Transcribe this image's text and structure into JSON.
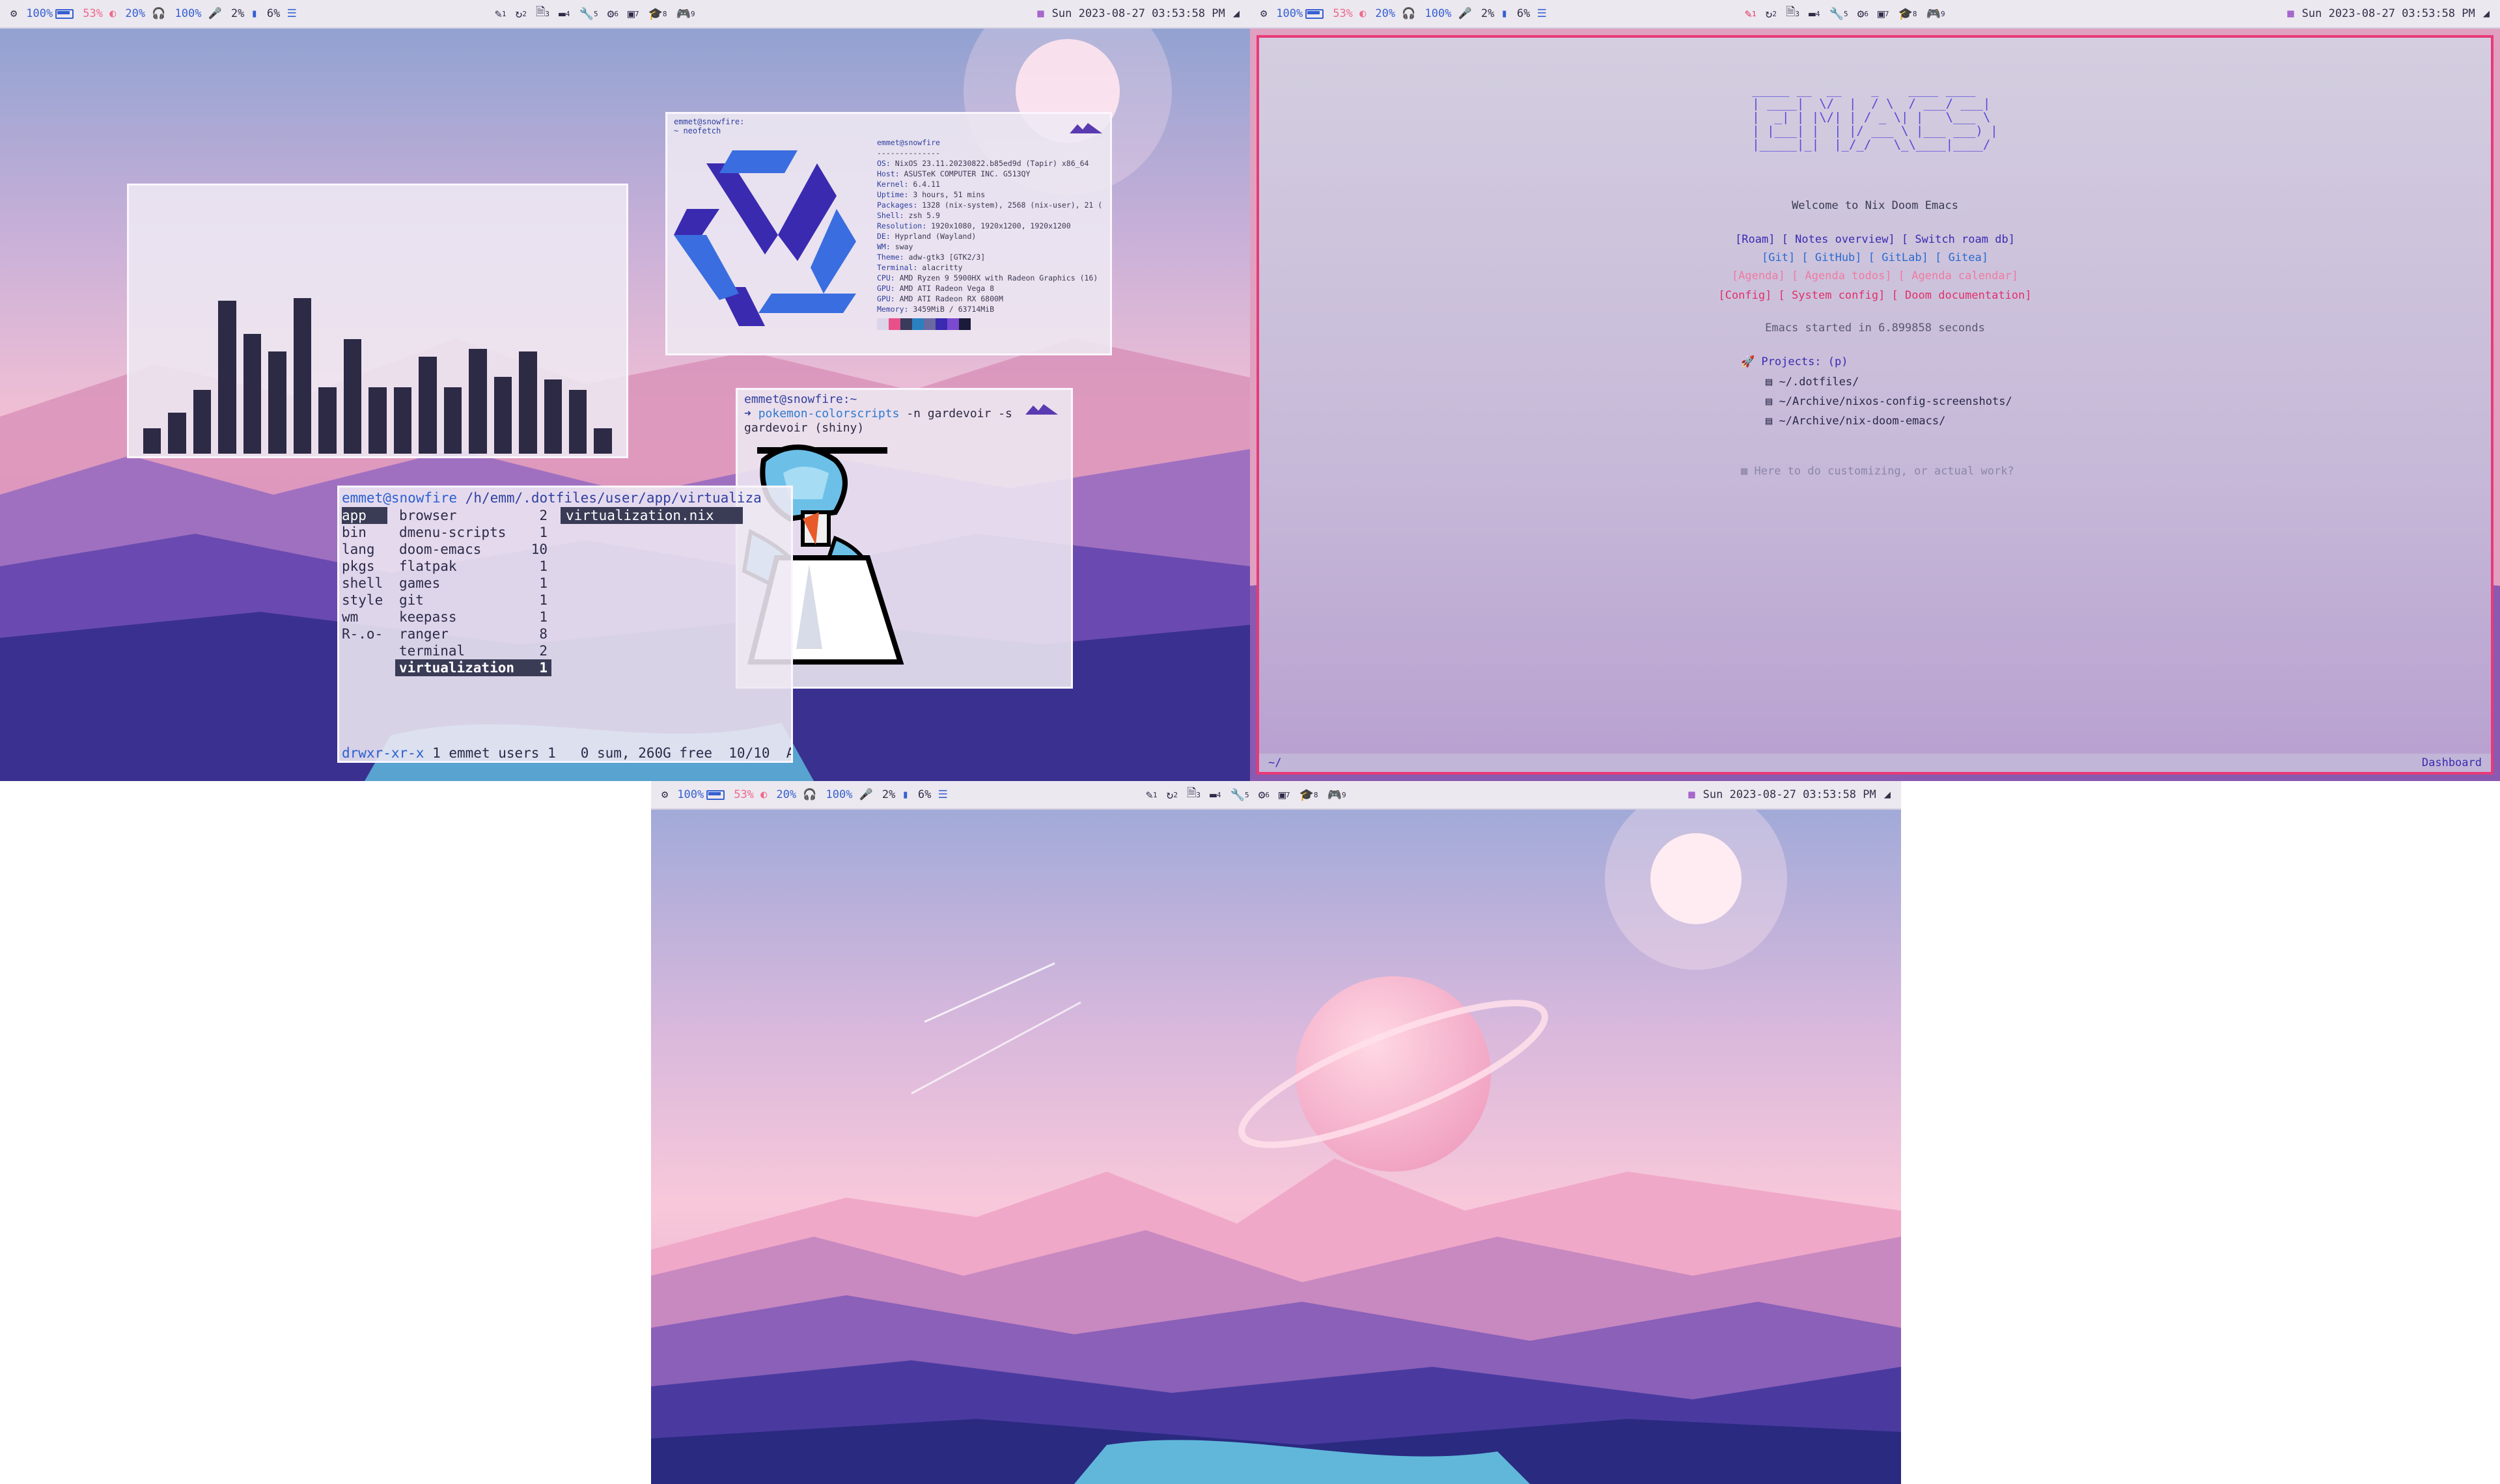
{
  "statusbar": {
    "cpu_icon": "gear-icon",
    "battery": "100%",
    "brightness": "53%",
    "volume": "20%",
    "mic": "100%",
    "ram": "2%",
    "disk": "6%",
    "workspaces": [
      {
        "icon": "pen-icon",
        "num": "1"
      },
      {
        "icon": "refresh-icon",
        "num": "2"
      },
      {
        "icon": "file-icon",
        "num": "3"
      },
      {
        "icon": "folder-icon",
        "num": "4"
      },
      {
        "icon": "wrench-icon",
        "num": "5"
      },
      {
        "icon": "gear-icon",
        "num": "6"
      },
      {
        "icon": "vm-icon",
        "num": "7"
      },
      {
        "icon": "graduation-icon",
        "num": "8"
      },
      {
        "icon": "gamepad-icon",
        "num": "9"
      }
    ],
    "datetime": "Sun 2023-08-27 03:53:58 PM",
    "colors": {
      "accent": "#3560d0",
      "warn": "#ee6a8a"
    }
  },
  "neofetch": {
    "prompt": "emmet@snowfire:",
    "command": "~ neofetch",
    "userhost": "emmet@snowfire",
    "separator": "--------------",
    "rows": [
      {
        "k": "OS:",
        "v": "NixOS 23.11.20230822.b85ed9d (Tapir) x86_64"
      },
      {
        "k": "Host:",
        "v": "ASUSTeK COMPUTER INC. G513QY"
      },
      {
        "k": "Kernel:",
        "v": "6.4.11"
      },
      {
        "k": "Uptime:",
        "v": "3 hours, 51 mins"
      },
      {
        "k": "Packages:",
        "v": "1328 (nix-system), 2568 (nix-user), 21 ("
      },
      {
        "k": "Shell:",
        "v": "zsh 5.9"
      },
      {
        "k": "Resolution:",
        "v": "1920x1080, 1920x1200, 1920x1200"
      },
      {
        "k": "DE:",
        "v": "Hyprland (Wayland)"
      },
      {
        "k": "WM:",
        "v": "sway"
      },
      {
        "k": "Theme:",
        "v": "adw-gtk3 [GTK2/3]"
      },
      {
        "k": "Terminal:",
        "v": "alacritty"
      },
      {
        "k": "CPU:",
        "v": "AMD Ryzen 9 5900HX with Radeon Graphics (16)"
      },
      {
        "k": "GPU:",
        "v": "AMD ATI Radeon Vega 8"
      },
      {
        "k": "GPU:",
        "v": "AMD ATI Radeon RX 6800M"
      },
      {
        "k": "Memory:",
        "v": "3459MiB / 63714MiB"
      }
    ]
  },
  "pokemon": {
    "prompt": "emmet@snowfire:~",
    "command": "pokemon-colorscripts",
    "args": "-n gardevoir -s",
    "output": "gardevoir (shiny)"
  },
  "ranger": {
    "header_user": "emmet@snowfire",
    "header_path": "/h/emm/.dotfiles/user/app/virtualiza",
    "col1": [
      "app",
      "bin",
      "lang",
      "pkgs",
      "shell",
      "style",
      "wm",
      "R-.o-"
    ],
    "col2": [
      {
        "name": "browser",
        "count": "2"
      },
      {
        "name": "dmenu-scripts",
        "count": "1"
      },
      {
        "name": "doom-emacs",
        "count": "10"
      },
      {
        "name": "flatpak",
        "count": "1"
      },
      {
        "name": "games",
        "count": "1"
      },
      {
        "name": "git",
        "count": "1"
      },
      {
        "name": "keepass",
        "count": "1"
      },
      {
        "name": "ranger",
        "count": "8"
      },
      {
        "name": "terminal",
        "count": "2"
      },
      {
        "name": "virtualization",
        "count": "1"
      }
    ],
    "col3": [
      "virtualization.nix"
    ],
    "footer_perm": "drwxr-xr-x",
    "footer_info": "1 emmet users 1",
    "footer_free": "0 sum, 260G free",
    "footer_pos": "10/10",
    "footer_all": "All"
  },
  "visualizer": {
    "values": [
      0.1,
      0.16,
      0.25,
      0.6,
      0.47,
      0.4,
      0.61,
      0.26,
      0.45,
      0.26,
      0.26,
      0.38,
      0.26,
      0.41,
      0.3,
      0.4,
      0.29,
      0.25,
      0.1
    ]
  },
  "emacs": {
    "banner": "_____ __  __    _    ____ ____\n| ____|  \\/  |  / \\  / ___/ ___|\n|  _| | |\\/| | / _ \\| |   \\___ \\\n| |___| |  | |/ ___ \\ |___ ___) |\n|_____|_|  |_/_/   \\_\\____|____/",
    "welcome": "Welcome to Nix Doom Emacs",
    "row1": "[Roam] [  Notes overview] [  Switch roam db]",
    "row2": "[Git] [  GitHub] [  GitLab] [  Gitea]",
    "row3": "[Agenda] [  Agenda todos] [  Agenda calendar]",
    "row4": "[Config] [  System config] [  Doom documentation]",
    "started": "Emacs started in 6.899858 seconds",
    "projects_label": "Projects: (p)",
    "projects": [
      "~/.dotfiles/",
      "~/Archive/nixos-config-screenshots/",
      "~/Archive/nix-doom-emacs/"
    ],
    "todo": "Here to do customizing, or actual work?",
    "modeline_left": "~/",
    "modeline_right": "Dashboard"
  }
}
